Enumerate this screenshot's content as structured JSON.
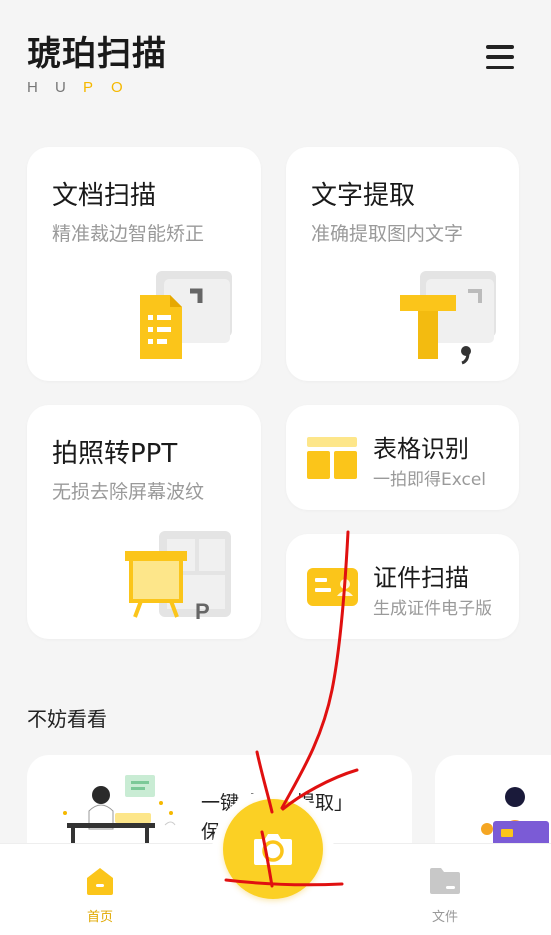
{
  "app": {
    "title": "琥珀扫描",
    "sub_letters": [
      "H",
      "U",
      "P",
      "O"
    ]
  },
  "features": {
    "doc": {
      "title": "文档扫描",
      "subtitle": "精准裁边智能矫正"
    },
    "text": {
      "title": "文字提取",
      "subtitle": "准确提取图内文字"
    },
    "ppt": {
      "title": "拍照转PPT",
      "subtitle": "无损去除屏幕波纹"
    },
    "table": {
      "title": "表格识别",
      "subtitle": "一拍即得Excel"
    },
    "id": {
      "title": "证件扫描",
      "subtitle": "生成证件电子版"
    }
  },
  "section": {
    "title": "不妨看看"
  },
  "promo": {
    "line1": "一键「文字提取」",
    "line2": "保存"
  },
  "tabbar": {
    "home_label": "首页",
    "files_label": "文件"
  },
  "colors": {
    "accent": "#f5b800",
    "camera": "#fbd024",
    "annotation": "#e01010"
  },
  "icons": {
    "menu": "hamburger-menu-icon",
    "home": "home-icon",
    "camera": "camera-icon",
    "files": "folder-icon"
  }
}
